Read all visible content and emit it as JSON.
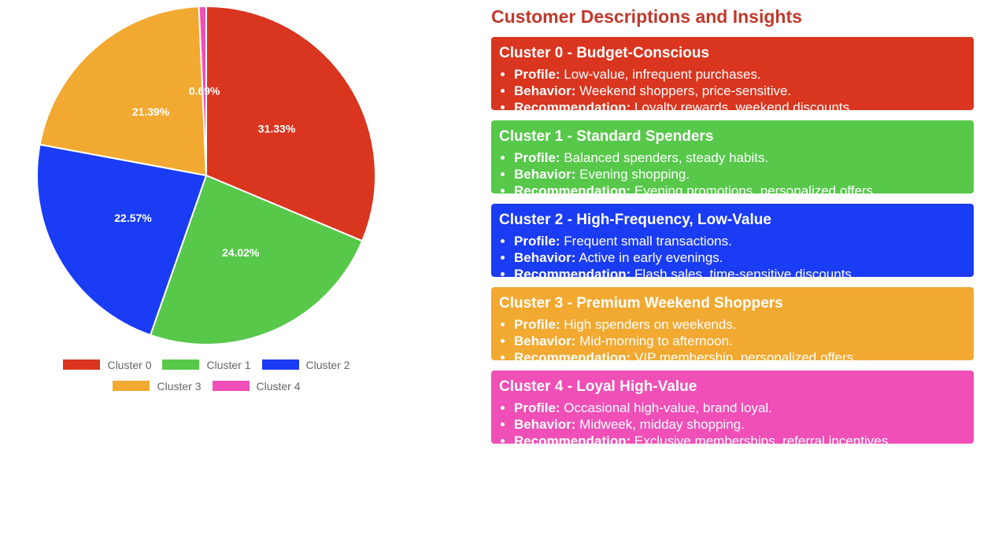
{
  "chart_data": {
    "type": "pie",
    "slices": [
      {
        "label": "Cluster 0",
        "value": 31.33,
        "display": "31.33%",
        "color": "#d9351f"
      },
      {
        "label": "Cluster 1",
        "value": 24.02,
        "display": "24.02%",
        "color": "#57c84a"
      },
      {
        "label": "Cluster 2",
        "value": 22.57,
        "display": "22.57%",
        "color": "#1a3cf5"
      },
      {
        "label": "Cluster 3",
        "value": 21.39,
        "display": "21.39%",
        "color": "#f2a931"
      },
      {
        "label": "Cluster 4",
        "value": 0.69,
        "display": "0.69%",
        "color": "#ef4fb6"
      }
    ],
    "legend_position": "bottom"
  },
  "insights": {
    "title": "Customer Descriptions and Insights",
    "clusters": [
      {
        "title": "Cluster 0 - Budget-Conscious",
        "color": "#d9351f",
        "profile_label": "Profile:",
        "profile": "Low-value, infrequent purchases.",
        "behavior_label": "Behavior:",
        "behavior": "Weekend shoppers, price-sensitive.",
        "recommendation_label": "Recommendation:",
        "recommendation": "Loyalty rewards, weekend discounts."
      },
      {
        "title": "Cluster 1 - Standard Spenders",
        "color": "#57c84a",
        "profile_label": "Profile:",
        "profile": "Balanced spenders, steady habits.",
        "behavior_label": "Behavior:",
        "behavior": "Evening shopping.",
        "recommendation_label": "Recommendation:",
        "recommendation": "Evening promotions, personalized offers."
      },
      {
        "title": "Cluster 2 - High-Frequency, Low-Value",
        "color": "#1a3cf5",
        "profile_label": "Profile:",
        "profile": "Frequent small transactions.",
        "behavior_label": "Behavior:",
        "behavior": "Active in early evenings.",
        "recommendation_label": "Recommendation:",
        "recommendation": "Flash sales, time-sensitive discounts."
      },
      {
        "title": "Cluster 3 - Premium Weekend Shoppers",
        "color": "#f2a931",
        "profile_label": "Profile:",
        "profile": "High spenders on weekends.",
        "behavior_label": "Behavior:",
        "behavior": "Mid-morning to afternoon.",
        "recommendation_label": "Recommendation:",
        "recommendation": "VIP membership, personalized offers."
      },
      {
        "title": "Cluster 4 - Loyal High-Value",
        "color": "#ef4fb6",
        "profile_label": "Profile:",
        "profile": "Occasional high-value, brand loyal.",
        "behavior_label": "Behavior:",
        "behavior": "Midweek, midday shopping.",
        "recommendation_label": "Recommendation:",
        "recommendation": "Exclusive memberships, referral incentives."
      }
    ]
  }
}
